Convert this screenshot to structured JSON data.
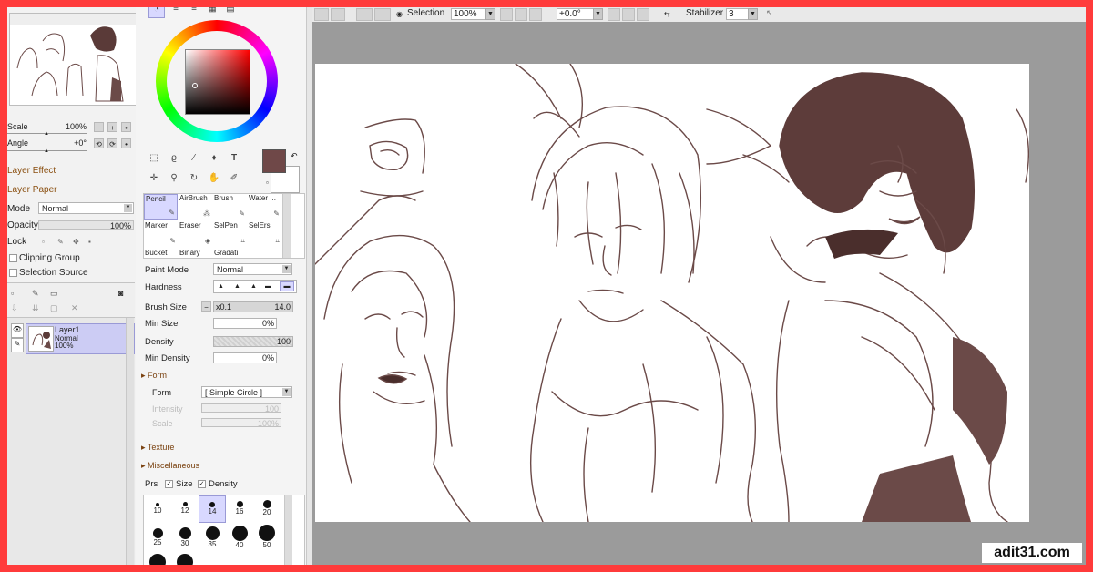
{
  "toolbar": {
    "selection_label": "Selection",
    "zoom_value": "100%",
    "rotation_value": "+0.0°",
    "stabilizer_label": "Stabilizer",
    "stabilizer_value": "3"
  },
  "navigator": {
    "scale_label": "Scale",
    "scale_value": "100%",
    "angle_label": "Angle",
    "angle_value": "+0°"
  },
  "layer_panel": {
    "layer_effect": "Layer Effect",
    "layer_paper": "Layer Paper",
    "mode_label": "Mode",
    "mode_value": "Normal",
    "opacity_label": "Opacity",
    "opacity_value": "100%",
    "lock_label": "Lock",
    "clipping_group": "Clipping Group",
    "selection_source": "Selection Source",
    "layers": [
      {
        "name": "Layer1",
        "mode": "Normal",
        "opacity": "100%"
      }
    ]
  },
  "colors": {
    "primary": "#6f4848",
    "secondary": "#ffffff",
    "accent_selection": "#d8d8ff",
    "ink": "#6b4a48"
  },
  "brush_presets": [
    {
      "name": "Pencil",
      "selected": true
    },
    {
      "name": "AirBrush"
    },
    {
      "name": "Brush"
    },
    {
      "name": "Water ..."
    },
    {
      "name": "Marker"
    },
    {
      "name": "Eraser"
    },
    {
      "name": "SelPen"
    },
    {
      "name": "SelErs"
    },
    {
      "name": "Bucket"
    },
    {
      "name": "Binary"
    },
    {
      "name": "Gradati"
    }
  ],
  "brush_settings": {
    "paint_mode_label": "Paint Mode",
    "paint_mode_value": "Normal",
    "hardness_label": "Hardness",
    "brush_size_label": "Brush Size",
    "brush_size_multiplier": "x0.1",
    "brush_size_value": "14.0",
    "min_size_label": "Min Size",
    "min_size_value": "0%",
    "density_label": "Density",
    "density_value": "100",
    "min_density_label": "Min Density",
    "min_density_value": "0%",
    "form_section": "Form",
    "form_label": "Form",
    "form_value": "[ Simple Circle ]",
    "intensity_label": "Intensity",
    "intensity_value": "100",
    "scale_label": "Scale",
    "scale_value": "100%",
    "texture_section": "Texture",
    "misc_section": "Miscellaneous",
    "prs_label": "Prs",
    "size_label": "Size",
    "density_check_label": "Density"
  },
  "brush_sizes": [
    "10",
    "12",
    "14",
    "16",
    "20",
    "25",
    "30",
    "35",
    "40",
    "50"
  ],
  "watermark": "adit31.com"
}
